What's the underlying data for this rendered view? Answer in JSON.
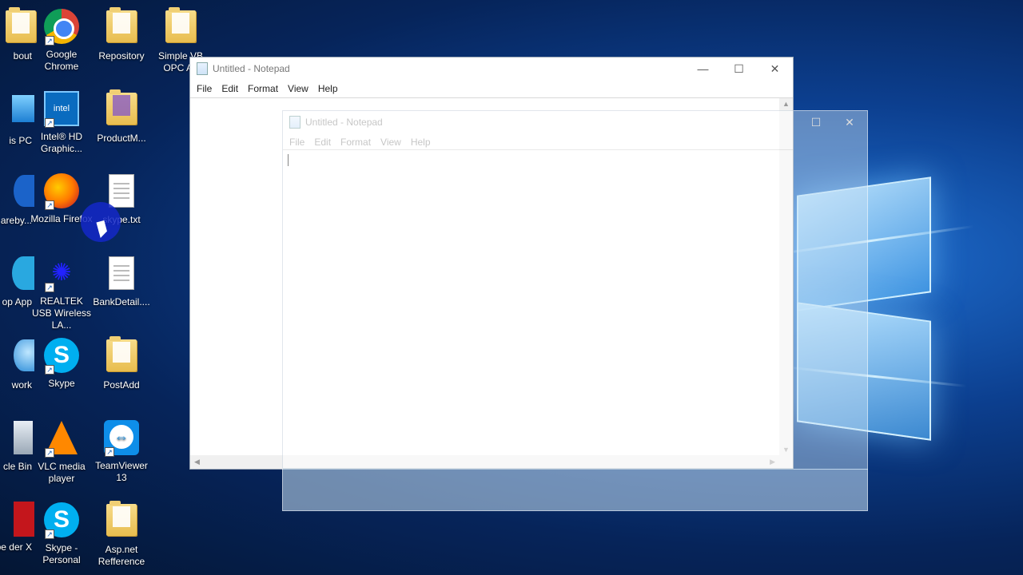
{
  "desktop": {
    "icons": [
      {
        "label": "bout"
      },
      {
        "label": "Google Chrome"
      },
      {
        "label": "Repository"
      },
      {
        "label": "Simple VB OPC Au"
      },
      {
        "label": "is PC"
      },
      {
        "label": "Intel® HD Graphic..."
      },
      {
        "label": "ProductM..."
      },
      {
        "label": "areby..."
      },
      {
        "label": "Mozilla Firefox"
      },
      {
        "label": "skype.txt"
      },
      {
        "label": "lancer op App"
      },
      {
        "label": "REALTEK USB Wireless LA..."
      },
      {
        "label": "BankDetail...."
      },
      {
        "label": "work"
      },
      {
        "label": "Skype"
      },
      {
        "label": "PostAdd"
      },
      {
        "label": "cle Bin"
      },
      {
        "label": "VLC media player"
      },
      {
        "label": "TeamViewer 13"
      },
      {
        "label": "obe der X"
      },
      {
        "label": "Skype - Personal"
      },
      {
        "label": "Asp.net Refference"
      }
    ]
  },
  "notepad_main": {
    "title": "Untitled - Notepad",
    "menu": [
      "File",
      "Edit",
      "Format",
      "View",
      "Help"
    ],
    "controls": {
      "minimize": "—",
      "maximize": "☐",
      "close": "✕"
    }
  },
  "notepad_ghost": {
    "title": "Untitled - Notepad",
    "menu": [
      "File",
      "Edit",
      "Format",
      "View",
      "Help"
    ],
    "controls": {
      "minimize": "—",
      "maximize": "☐",
      "close": "✕"
    }
  },
  "colors": {
    "accent": "#0c3f8f",
    "title_text": "#777777"
  }
}
